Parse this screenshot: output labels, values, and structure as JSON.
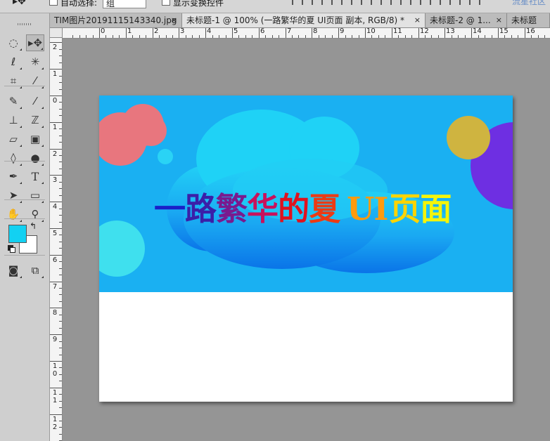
{
  "options_bar": {
    "auto_select_label": "自动选择:",
    "auto_select_value": "组",
    "show_transform_label": "显示变换控件",
    "watermark": "流星社区"
  },
  "tabs": [
    {
      "label": "TIM图片20191115143340.jpg",
      "close": "×",
      "active": false
    },
    {
      "label": "未标题-1 @ 100% (一路繁华的夏 UI页面 副本, RGB/8) *",
      "close": "×",
      "active": true
    },
    {
      "label": "未标题-2 @ 1...",
      "close": "×",
      "active": false
    },
    {
      "label": "未标题",
      "close": "",
      "active": false
    }
  ],
  "ruler_h_labels": [
    "0",
    "1",
    "2",
    "3",
    "4",
    "5",
    "6",
    "7",
    "8",
    "9",
    "10",
    "11",
    "12",
    "13",
    "14",
    "15",
    "16"
  ],
  "ruler_v_labels": [
    "2",
    "1",
    "0",
    "1",
    "2",
    "3",
    "4",
    "5",
    "6",
    "7",
    "8",
    "9",
    "10",
    "11",
    "12"
  ],
  "toolbox": {
    "foreground_color": "#12d1f2",
    "background_color": "#ffffff",
    "tools": [
      {
        "name": "marquee",
        "icon": "dashed-ellipse-icon"
      },
      {
        "name": "move",
        "icon": "move-arrow-icon",
        "active": true
      },
      {
        "name": "lasso",
        "icon": "lasso-icon"
      },
      {
        "name": "magic-wand",
        "icon": "magic-wand-icon"
      },
      {
        "name": "crop",
        "icon": "crop-icon"
      },
      {
        "name": "eyedropper",
        "icon": "eyedropper-icon"
      },
      {
        "name": "healing-brush",
        "icon": "bandage-icon"
      },
      {
        "name": "brush",
        "icon": "brush-icon"
      },
      {
        "name": "clone-stamp",
        "icon": "stamp-icon"
      },
      {
        "name": "history-brush",
        "icon": "history-brush-icon"
      },
      {
        "name": "eraser",
        "icon": "eraser-icon"
      },
      {
        "name": "gradient",
        "icon": "gradient-icon"
      },
      {
        "name": "blur",
        "icon": "drop-icon"
      },
      {
        "name": "dodge",
        "icon": "dodge-icon"
      },
      {
        "name": "pen",
        "icon": "pen-icon"
      },
      {
        "name": "type",
        "icon": "type-icon",
        "glyph": "T"
      },
      {
        "name": "path-selection",
        "icon": "arrow-icon"
      },
      {
        "name": "shape",
        "icon": "rectangle-icon"
      },
      {
        "name": "hand",
        "icon": "hand-icon"
      },
      {
        "name": "zoom",
        "icon": "zoom-icon"
      },
      {
        "name": "quick-mask",
        "icon": "quick-mask-icon"
      },
      {
        "name": "screen-mode",
        "icon": "screen-mode-icon"
      }
    ]
  },
  "document": {
    "banner_color": "#1ab0f2",
    "headline": [
      {
        "text": "一",
        "color": "#1a20c8"
      },
      {
        "text": "路",
        "color": "#3b1fa8"
      },
      {
        "text": "繁",
        "color": "#7a1a8e"
      },
      {
        "text": "华",
        "color": "#c8125c"
      },
      {
        "text": "的",
        "color": "#e0121e"
      },
      {
        "text": "夏",
        "color": "#ec3a14"
      },
      {
        "text": " UI",
        "color": "#ff9a0e"
      },
      {
        "text": "页",
        "color": "#ffd400"
      },
      {
        "text": "面",
        "color": "#f4f40a"
      }
    ]
  }
}
